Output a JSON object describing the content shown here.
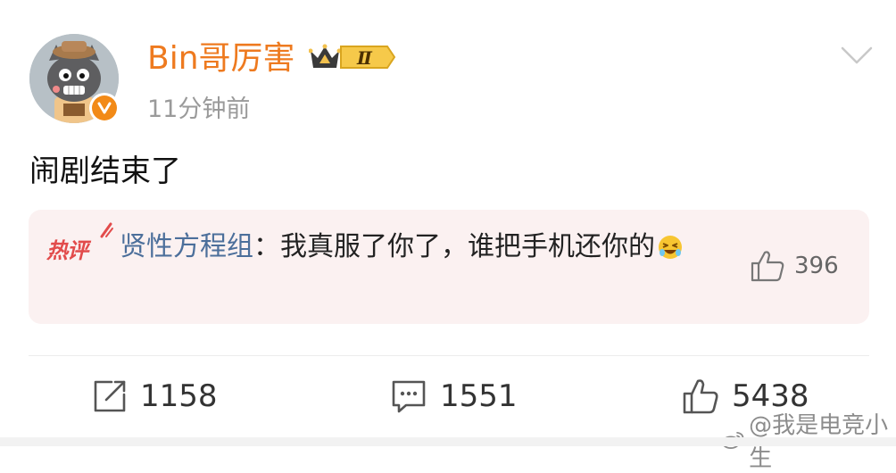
{
  "post": {
    "username": "Bin哥厉害",
    "vip_level": "Ⅱ",
    "timestamp": "11分钟前",
    "text": "闹剧结束了"
  },
  "hot_comment": {
    "tag": "热评",
    "author": "贤性方程组",
    "separator": "：",
    "text": "我真服了你了，谁把手机还你的",
    "likes": "396"
  },
  "actions": {
    "reposts": "1158",
    "comments": "1551",
    "likes": "5438"
  },
  "watermark": {
    "text": "@我是电竞小生"
  },
  "colors": {
    "username": "#ee7a1f",
    "hot_tag": "#e24b4b",
    "comment_author": "#4c6f9b",
    "card_bg": "#fbf1f1",
    "verified": "#f28a17"
  },
  "icons": {
    "chevron": "chevron-down-icon",
    "repost": "repost-icon",
    "comment": "comment-icon",
    "like": "thumbs-up-icon",
    "verified": "verified-badge-icon",
    "vip": "crown-icon"
  }
}
